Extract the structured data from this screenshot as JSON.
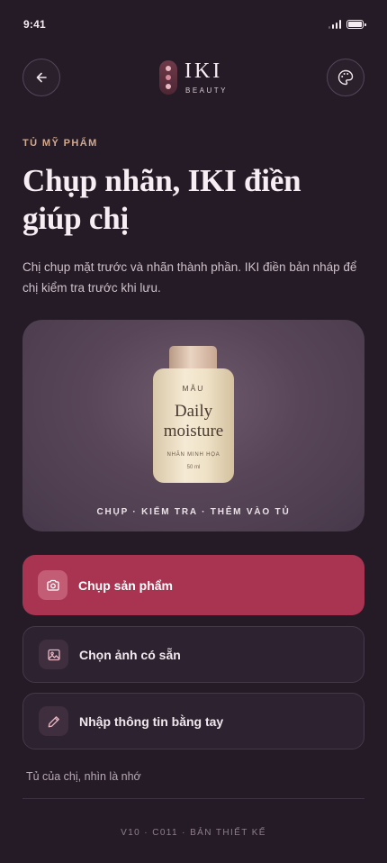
{
  "status": {
    "time": "9:41"
  },
  "header": {
    "brand_name": "IKI",
    "brand_sub": "BEAUTY"
  },
  "content": {
    "eyebrow": "TỦ MỸ PHẨM",
    "title_line1": "Chụp nhãn, IKI điền",
    "title_line2": "giúp chị",
    "subtitle": "Chị chụp mặt trước và nhãn thành phần. IKI điền bản nháp để chị kiểm tra trước khi lưu."
  },
  "hero": {
    "bottle_tag": "MẪU",
    "bottle_name_line1": "Daily",
    "bottle_name_line2": "moisture",
    "bottle_note": "NHÃN MINH HỌA",
    "bottle_volume": "50 ml",
    "caption": "CHỤP · KIỂM TRA · THÊM VÀO TỦ"
  },
  "actions": {
    "capture": "Chụp sản phẩm",
    "choose_photo": "Chọn ảnh có sẵn",
    "manual_entry": "Nhập thông tin bằng tay"
  },
  "footer": {
    "note": "Tủ của chị, nhìn là nhớ",
    "version": "V10 · C011 · BẢN THIẾT KẾ"
  },
  "colors": {
    "background": "#241b26",
    "primary": "#a93452",
    "accent_eyebrow": "#d3a98e"
  }
}
